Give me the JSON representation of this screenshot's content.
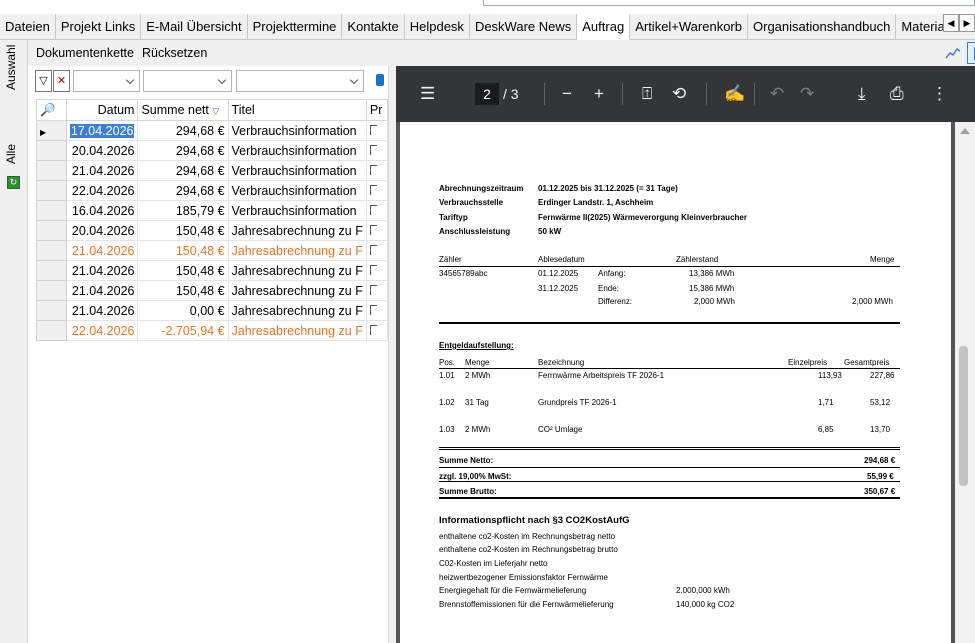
{
  "tabs": [
    {
      "label": "Dateien"
    },
    {
      "label": "Projekt Links"
    },
    {
      "label": "E-Mail Übersicht"
    },
    {
      "label": "Projekttermine"
    },
    {
      "label": "Kontakte"
    },
    {
      "label": "Helpdesk"
    },
    {
      "label": "DeskWare News"
    },
    {
      "label": "Auftrag",
      "active": true
    },
    {
      "label": "Artikel+Warenkorb"
    },
    {
      "label": "Organisationshandbuch"
    },
    {
      "label": "Materialbedarf"
    }
  ],
  "sidebar": {
    "auswahl": "Auswahl",
    "alle": "Alle"
  },
  "toolbar": {
    "dokumentenkette": "Dokumentenkette",
    "ruecksetzen": "Rücksetzen"
  },
  "grid": {
    "columns": {
      "datum": "Datum",
      "summe": "Summe nett",
      "titel": "Titel",
      "pr": "Pr"
    },
    "rows": [
      {
        "datum": "17.04.2026",
        "summe": "294,68 €",
        "titel": "Verbrauchsinformation",
        "orange": false,
        "current": true
      },
      {
        "datum": "20.04.2026",
        "summe": "294,68 €",
        "titel": "Verbrauchsinformation",
        "orange": false
      },
      {
        "datum": "21.04.2026",
        "summe": "294,68 €",
        "titel": "Verbrauchsinformation",
        "orange": false
      },
      {
        "datum": "22.04.2026",
        "summe": "294,68 €",
        "titel": "Verbrauchsinformation",
        "orange": false
      },
      {
        "datum": "16.04.2026",
        "summe": "185,79 €",
        "titel": "Verbrauchsinformation",
        "orange": false
      },
      {
        "datum": "20.04.2026",
        "summe": "150,48 €",
        "titel": "Jahresabrechnung zu F",
        "orange": false
      },
      {
        "datum": "21.04.2026",
        "summe": "150,48 €",
        "titel": "Jahresabrechnung zu F",
        "orange": true
      },
      {
        "datum": "21.04.2026",
        "summe": "150,48 €",
        "titel": "Jahresabrechnung zu F",
        "orange": false
      },
      {
        "datum": "21.04.2026",
        "summe": "150,48 €",
        "titel": "Jahresabrechnung zu F",
        "orange": false
      },
      {
        "datum": "21.04.2026",
        "summe": "0,00 €",
        "titel": "Jahresabrechnung zu F",
        "orange": false
      },
      {
        "datum": "22.04.2026",
        "summe": "-2.705,94 €",
        "titel": "Jahresabrechnung zu F",
        "orange": true
      }
    ]
  },
  "pdf": {
    "page_current": "2",
    "page_total": "/ 3",
    "header": {
      "abrechnungszeitraum_label": "Abrechnungszeitraum",
      "abrechnungszeitraum": "01.12.2025 bis 31.12.2025 (= 31 Tage)",
      "verbrauchsstelle_label": "Verbrauchsstelle",
      "verbrauchsstelle": "Erdinger Landstr. 1, Aschheim",
      "tariftyp_label": "Tariftyp",
      "tariftyp": "Fernwärme II(2025) Wärmeverorgung Kleinverbraucher",
      "anschluss_label": "Anschlussleistung",
      "anschluss": "50 kW"
    },
    "meter": {
      "h_zaehler": "Zähler",
      "h_ablesedatum": "Ablesedatum",
      "h_zaehlerstand": "Zählerstand",
      "h_menge": "Menge",
      "zaehler": "34565789abc",
      "date1": "01.12.2025",
      "anfang_label": "Anfang:",
      "anfang": "13,386 MWh",
      "date2": "31.12.2025",
      "ende_label": "Ende:",
      "ende": "15,386 MWh",
      "diff_label": "Differenz:",
      "diff": "2,000 MWh",
      "menge": "2,000 MWh"
    },
    "entgelt": {
      "title": "Entgeldaufstellung:",
      "h_pos": "Pos.",
      "h_menge": "Menge",
      "h_bez": "Bezeichnung",
      "h_einzel": "Einzelpreis",
      "h_gesamt": "Gesamtpreis",
      "items": [
        {
          "pos": "1.01",
          "menge": "2 MWh",
          "bez": "Ferrnwärme Arbeitspreis TF 2026-1",
          "einzel": "113,93",
          "gesamt": "227,86"
        },
        {
          "pos": "1.02",
          "menge": "31 Tag",
          "bez": "Grundpreis TF 2026-1",
          "einzel": "1,71",
          "gesamt": "53,12"
        },
        {
          "pos": "1.03",
          "menge": "2 MWh",
          "bez": "CO² Umlage",
          "einzel": "6,85",
          "gesamt": "13,70"
        }
      ],
      "netto_label": "Summe Netto:",
      "netto": "294,68 €",
      "mwst_label": "zzgl. 19,00% MwSt:",
      "mwst": "55,99 €",
      "brutto_label": "Summe Brutto:",
      "brutto": "350,67 €"
    },
    "info": {
      "title": "Informationspflicht nach §3 CO2KostAufG",
      "l1": "enthaltene co2-Kosten im Rechnungsbetrag netto",
      "l2": "enthaltene co2-Kosten im Rechnungsbetrag brutto",
      "l3": "C02-Kosten im Lieferjahr netto",
      "l4": "heizwertbezogener Emissionsfaktor Fernwärme",
      "l5": "Energiegehalt für die Fernwärmelieferung",
      "v5": "2.000,000 kWh",
      "l6": "Brennstoffemissionen für die Fernwärmelieferung",
      "v6": "140,000 kg CO2"
    }
  },
  "colors": {
    "orange": "#e8731f",
    "selection": "#3c7fd8",
    "pdf_toolbar": "#323639",
    "pdf_bg": "#525659"
  }
}
